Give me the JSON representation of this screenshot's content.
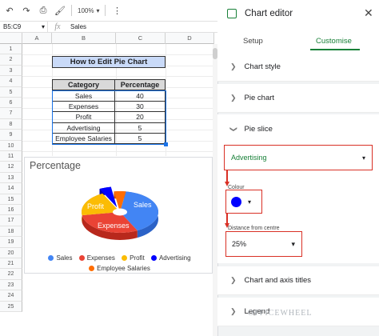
{
  "toolbar": {
    "zoom": "100%",
    "icons": [
      "undo-icon",
      "redo-icon",
      "print-icon",
      "paint-format-icon",
      "more-icon"
    ]
  },
  "formula_bar": {
    "name_box": "B5:C9",
    "fx": "fx",
    "value": "Sales"
  },
  "columns": [
    "A",
    "B",
    "C",
    "D"
  ],
  "rows": [
    "1",
    "2",
    "3",
    "4",
    "5",
    "6",
    "7",
    "8",
    "9",
    "10",
    "11",
    "12",
    "13",
    "14",
    "15",
    "16",
    "17",
    "18",
    "19",
    "20",
    "21",
    "22",
    "23",
    "24",
    "25"
  ],
  "sheet": {
    "title": "How to Edit Pie Chart",
    "headers": [
      "Category",
      "Percentage"
    ],
    "rows": [
      [
        "Sales",
        "40"
      ],
      [
        "Expenses",
        "30"
      ],
      [
        "Profit",
        "20"
      ],
      [
        "Advertising",
        "5"
      ],
      [
        "Employee Salaries",
        "5"
      ]
    ]
  },
  "chart": {
    "title": "Percentage",
    "slice_labels": {
      "sales": "Sales",
      "expenses": "Expenses",
      "profit": "Profit"
    },
    "legend": [
      "Sales",
      "Expenses",
      "Profit",
      "Advertising",
      "Employee Salaries"
    ],
    "colors": {
      "sales": "#4285f4",
      "expenses": "#ea4335",
      "profit": "#fbbc04",
      "advertising": "#0000ff",
      "salaries": "#ff6d01"
    }
  },
  "chart_data": {
    "type": "pie",
    "title": "Percentage",
    "categories": [
      "Sales",
      "Expenses",
      "Profit",
      "Advertising",
      "Employee Salaries"
    ],
    "values": [
      40,
      30,
      20,
      5,
      5
    ]
  },
  "editor": {
    "title": "Chart editor",
    "tabs": [
      "Setup",
      "Customise"
    ],
    "sections": [
      "Chart style",
      "Pie chart",
      "Pie slice",
      "Chart and axis titles",
      "Legend"
    ],
    "slice_select": "Advertising",
    "colour_label": "Colour",
    "colour_value": "#0000ff",
    "distance_label": "Distance from centre",
    "distance_value": "25%"
  },
  "watermark": "OFFICEWHEEL"
}
